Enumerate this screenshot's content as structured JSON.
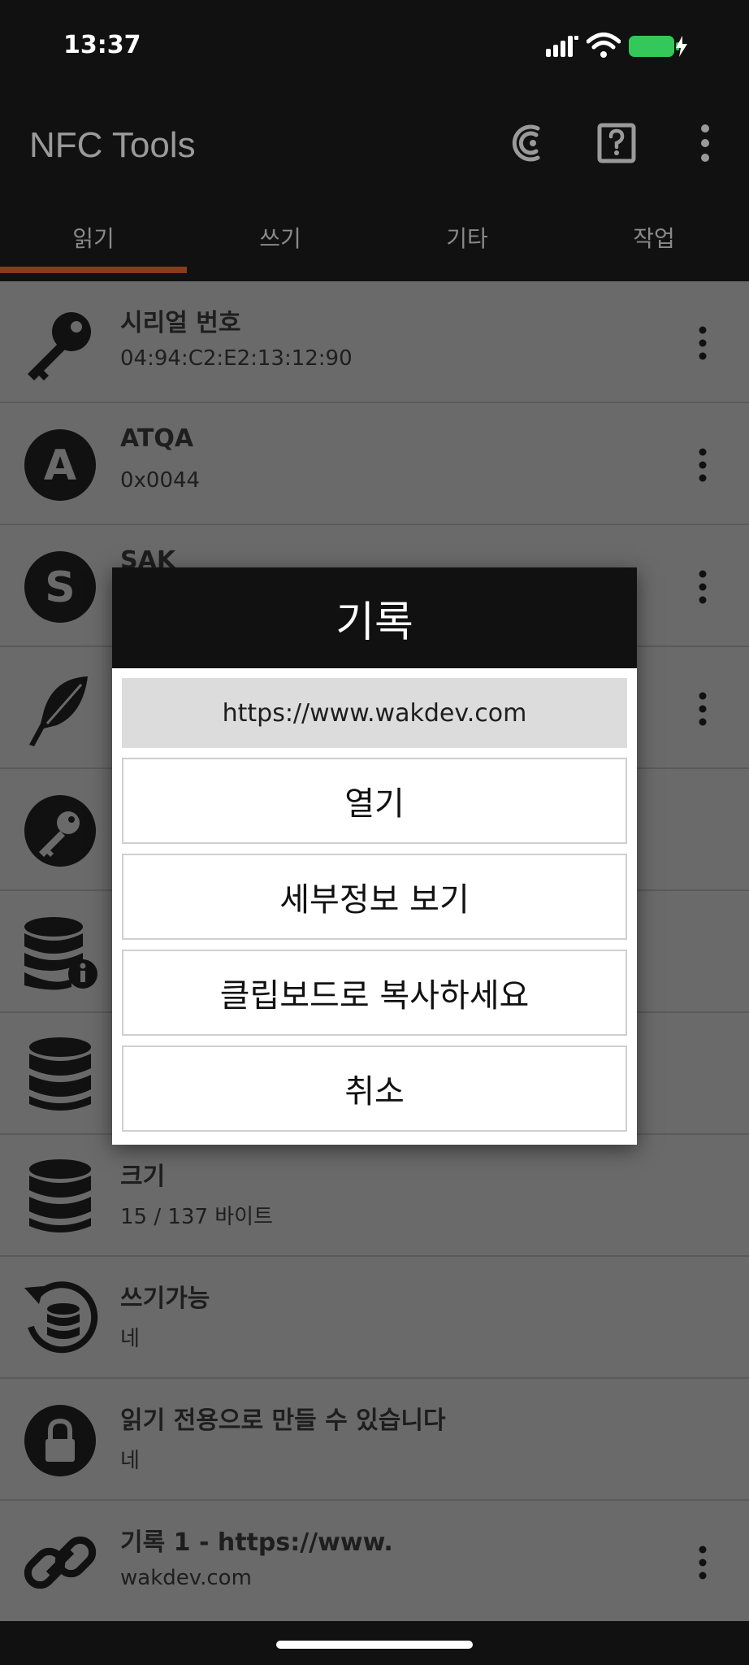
{
  "status_bar": {
    "time": "13:37"
  },
  "app_bar": {
    "title": "NFC Tools",
    "icons": [
      "nfc-scan-icon",
      "help-icon",
      "more-vert-icon"
    ]
  },
  "tabs": [
    {
      "label": "읽기",
      "active": true
    },
    {
      "label": "쓰기"
    },
    {
      "label": "기타"
    },
    {
      "label": "작업"
    }
  ],
  "list": [
    {
      "icon": "key-icon",
      "title": "시리얼 번호",
      "value": "04:94:C2:E2:13:12:90",
      "has_menu": true
    },
    {
      "icon": "letter-a-icon",
      "title": "ATQA",
      "value": "0x0044",
      "has_menu": true
    },
    {
      "icon": "letter-s-icon",
      "title": "SAK",
      "value": "",
      "has_menu": true
    },
    {
      "icon": "feather-icon",
      "title": "",
      "value": "",
      "has_menu": true
    },
    {
      "icon": "key-circle-icon",
      "title": "",
      "value": "",
      "has_menu": false
    },
    {
      "icon": "database-info-icon",
      "title": "",
      "value": "",
      "has_menu": false
    },
    {
      "icon": "database-icon",
      "title": "",
      "value": "",
      "has_menu": false
    },
    {
      "icon": "database-icon",
      "title": "크기",
      "value": "15 / 137 바이트",
      "has_menu": false
    },
    {
      "icon": "database-refresh-icon",
      "title": "쓰기가능",
      "value": "네",
      "has_menu": false
    },
    {
      "icon": "lock-icon",
      "title": "읽기 전용으로 만들 수 있습니다",
      "value": "네",
      "has_menu": false
    },
    {
      "icon": "link-icon",
      "title": "기록 1 - https://www.",
      "value": "wakdev.com",
      "has_menu": true
    }
  ],
  "dialog": {
    "title": "기록",
    "url": "https://www.wakdev.com",
    "buttons": [
      "열기",
      "세부정보 보기",
      "클립보드로 복사하세요",
      "취소"
    ]
  },
  "colors": {
    "accent": "#8a3c1c",
    "app_bar_bg": "#111111",
    "list_dimmed_bg": "#6a6a6a",
    "battery": "#34c759"
  }
}
